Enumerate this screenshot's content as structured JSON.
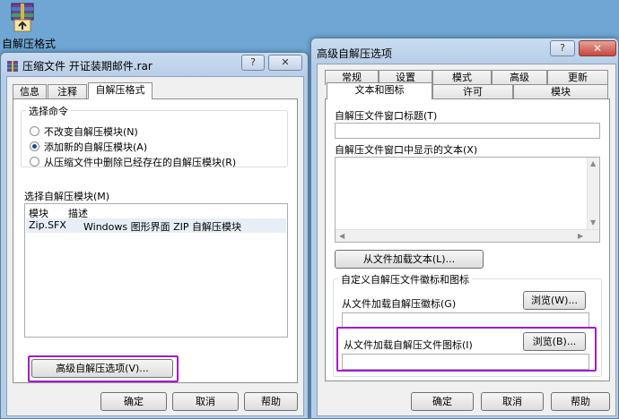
{
  "desktop": {
    "icon_label": "自解压格式"
  },
  "left_window": {
    "title": "压缩文件 开证装期邮件.rar",
    "help_btn": "?",
    "close_btn": "✕",
    "tabs": [
      "信息",
      "注释",
      "自解压格式"
    ],
    "command_group": {
      "title": "选择命令",
      "options": [
        "不改变自解压模块(N)",
        "添加新的自解压模块(A)",
        "从压缩文件中删除已经存在的自解压模块(R)"
      ],
      "selected": 1
    },
    "module_section": {
      "label": "选择自解压模块(M)",
      "columns": [
        "模块",
        "描述"
      ],
      "rows": [
        {
          "module": "Zip.SFX",
          "desc": "Windows 图形界面 ZIP 自解压模块"
        }
      ]
    },
    "advanced_button": "高级自解压选项(V)...",
    "ok": "确定",
    "cancel": "取消",
    "help": "帮助"
  },
  "right_window": {
    "title": "高级自解压选项",
    "help_btn": "?",
    "close_btn": "✕",
    "tabs_row1": [
      "常规",
      "设置",
      "模式",
      "高级",
      "更新"
    ],
    "tabs_row2": [
      "文本和图标",
      "许可",
      "模块"
    ],
    "title_label": "自解压文件窗口标题(T)",
    "text_label": "自解压文件窗口中显示的文本(X)",
    "load_text_button": "从文件加载文本(L)...",
    "logo_group": {
      "title": "自定义自解压文件徽标和图标",
      "logo_label": "从文件加载自解压徽标(G)",
      "logo_browse": "浏览(W)...",
      "icon_label": "从文件加载自解压文件图标(I)",
      "icon_browse": "浏览(B)..."
    },
    "ok": "确定",
    "cancel": "取消",
    "help": "帮助"
  }
}
